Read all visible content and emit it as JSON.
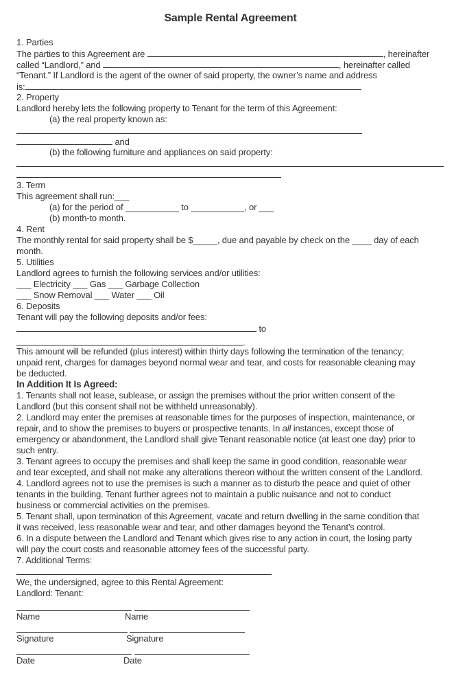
{
  "title": "Sample Rental Agreement",
  "sections": {
    "parties": {
      "heading": "1. Parties",
      "line1_a": "The parties to this Agreement are ",
      "line1_b": ", hereinafter",
      "line2_a": "called “Landlord,” and ",
      "line2_b": ", hereinafter called",
      "line3": "“Tenant.” If Landlord is the agent of the owner of said property, the owner’s name and address",
      "line4": "is:"
    },
    "property": {
      "heading": "2. Property",
      "intro": "Landlord hereby lets the following property to Tenant for the term of this Agreement:",
      "item_a": "(a) the real property known as:",
      "and": " and",
      "item_b": "(b) the following furniture and appliances on said property:"
    },
    "term": {
      "heading": "3. Term",
      "intro": "This agreement shall run:___",
      "item_a_prefix": "(a) for the period of ",
      "item_a_blank1": "___________",
      "item_a_to": " to ",
      "item_a_blank2": "___________",
      "item_a_suffix": ", or ___",
      "item_b": "(b) month-to month."
    },
    "rent": {
      "heading": "4. Rent",
      "line1": "The monthly rental for said property shall be $_____, due and payable by check on the ____ day of each",
      "line2": "month."
    },
    "utilities": {
      "heading": "5. Utilities",
      "intro": "Landlord agrees to furnish the following services and/or utilities:",
      "row1": "___ Electricity ___ Gas ___ Garbage Collection",
      "row2": "___ Snow Removal ___ Water ___ Oil"
    },
    "deposits": {
      "heading": "6. Deposits",
      "intro": "Tenant will pay the following deposits and/or fees:",
      "to": " to",
      "period": ".",
      "refund_lines": [
        "This amount will be refunded (plus interest) within thirty days following the termination of the tenancy;",
        "unpaid rent, charges for damages beyond normal wear and tear, and costs for reasonable cleaning may",
        "be deducted."
      ]
    },
    "additional": {
      "heading": "In Addition It Is Agreed:",
      "lines": [
        "1. Tenants shall not lease, sublease, or assign the premises without the prior written consent of the",
        "Landlord (but this consent shall not be withheld unreasonably).",
        "2. Landlord may enter the premises at reasonable times for the purposes of inspection, maintenance, or"
      ],
      "line_italic_a": "repair, and to show the premises to buyers or prospective tenants. In ",
      "line_italic_word": "all",
      "line_italic_b": " instances, except those of",
      "lines2": [
        "emergency or abandonment, the Landlord shall give Tenant reasonable notice (at least one day) prior to",
        "such entry.",
        "3. Tenant agrees to occupy the premises and shall keep the same in good condition, reasonable wear",
        "and tear excepted, and shall not make any alterations thereon without the written consent of the Landlord.",
        "4. Landlord agrees not to use the premises is such a manner as to disturb the peace and quiet of other",
        "tenants in the building. Tenant further agrees not to maintain a public nuisance and not to conduct",
        "business or commercial activities on the premises.",
        "5. Tenant shall, upon termination of this Agreement, vacate and return dwelling in the same condition that",
        "it was received, less reasonable wear and tear, and other damages beyond the Tenant’s control.",
        "6. In a dispute between the Landlord and Tenant which gives rise to any action in court, the losing party",
        "will pay the court costs and reasonable attorney fees of the successful party.",
        "7. Additional Terms:"
      ]
    },
    "signatures": {
      "intro": "We, the undersigned, agree to this Rental Agreement:",
      "parties": "Landlord: Tenant:",
      "name_label": "Name",
      "signature_label": "Signature",
      "date_label": "Date"
    }
  }
}
